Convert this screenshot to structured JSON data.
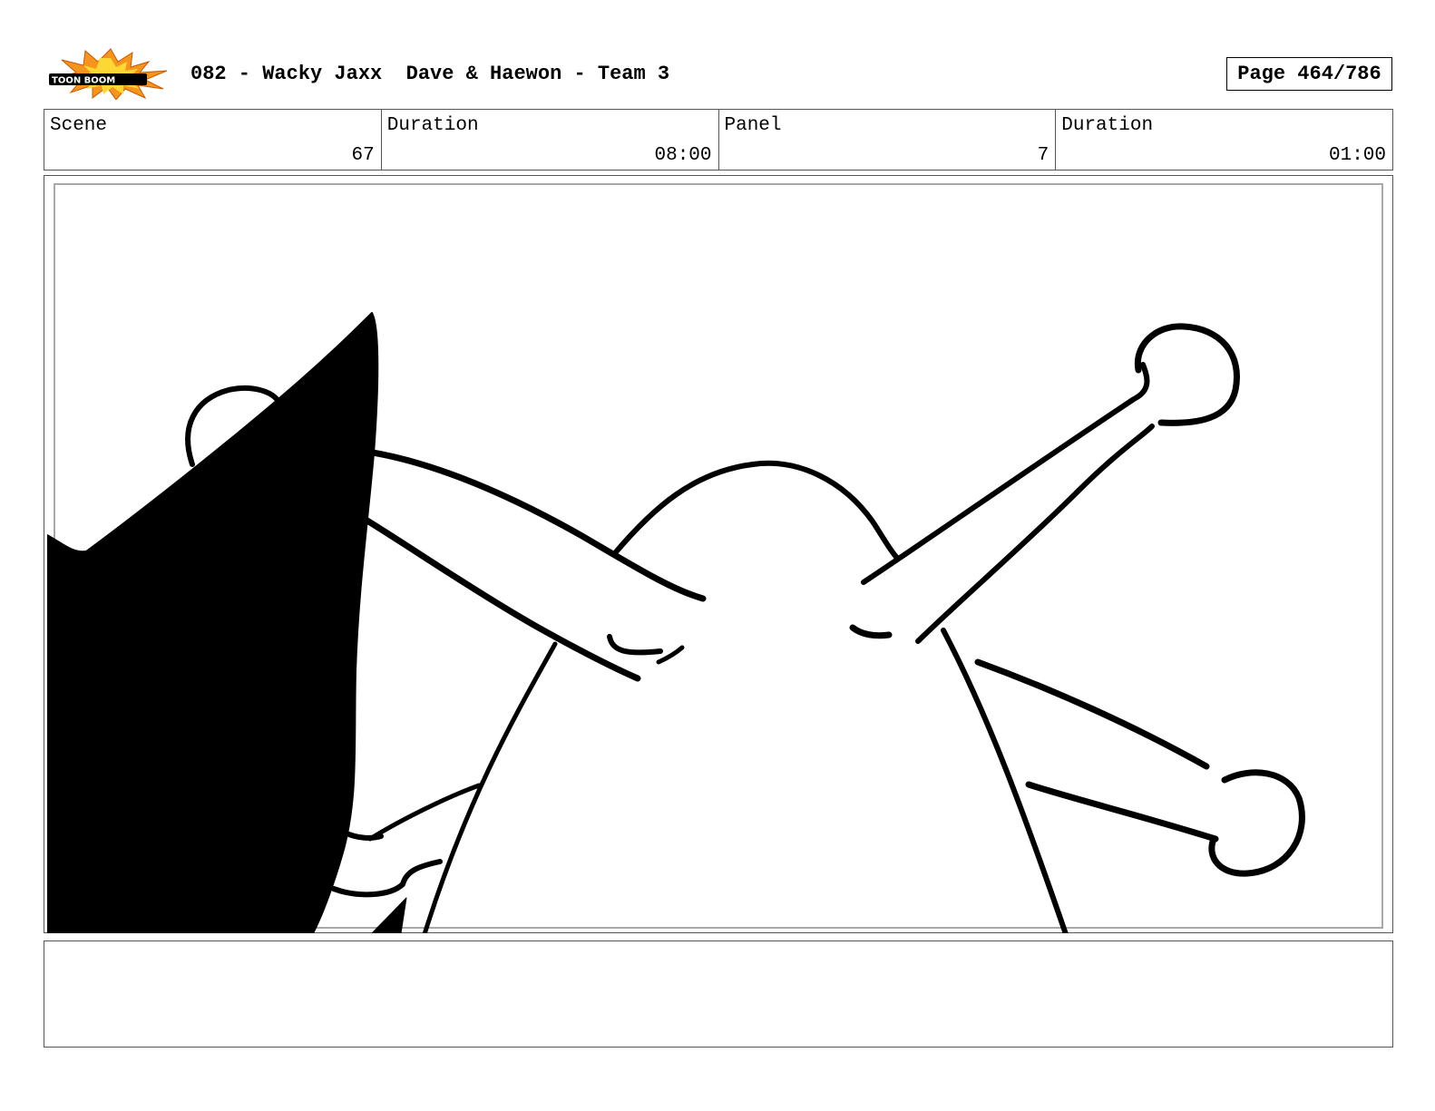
{
  "header": {
    "logo_text": "TOON BOOM",
    "title": "082 - Wacky Jaxx  Dave & Haewon - Team 3",
    "page_label": "Page 464/786"
  },
  "info": {
    "scene_label": "Scene",
    "scene_value": "67",
    "scene_duration_label": "Duration",
    "scene_duration_value": "08:00",
    "panel_label": "Panel",
    "panel_value": "7",
    "panel_duration_label": "Duration",
    "panel_duration_value": "01:00"
  },
  "notes": {
    "text": ""
  },
  "colors": {
    "logo_burst": "#f7941d",
    "logo_burst_inner": "#fdd835",
    "ink": "#000000",
    "frame_border": "#a8a8a8"
  }
}
